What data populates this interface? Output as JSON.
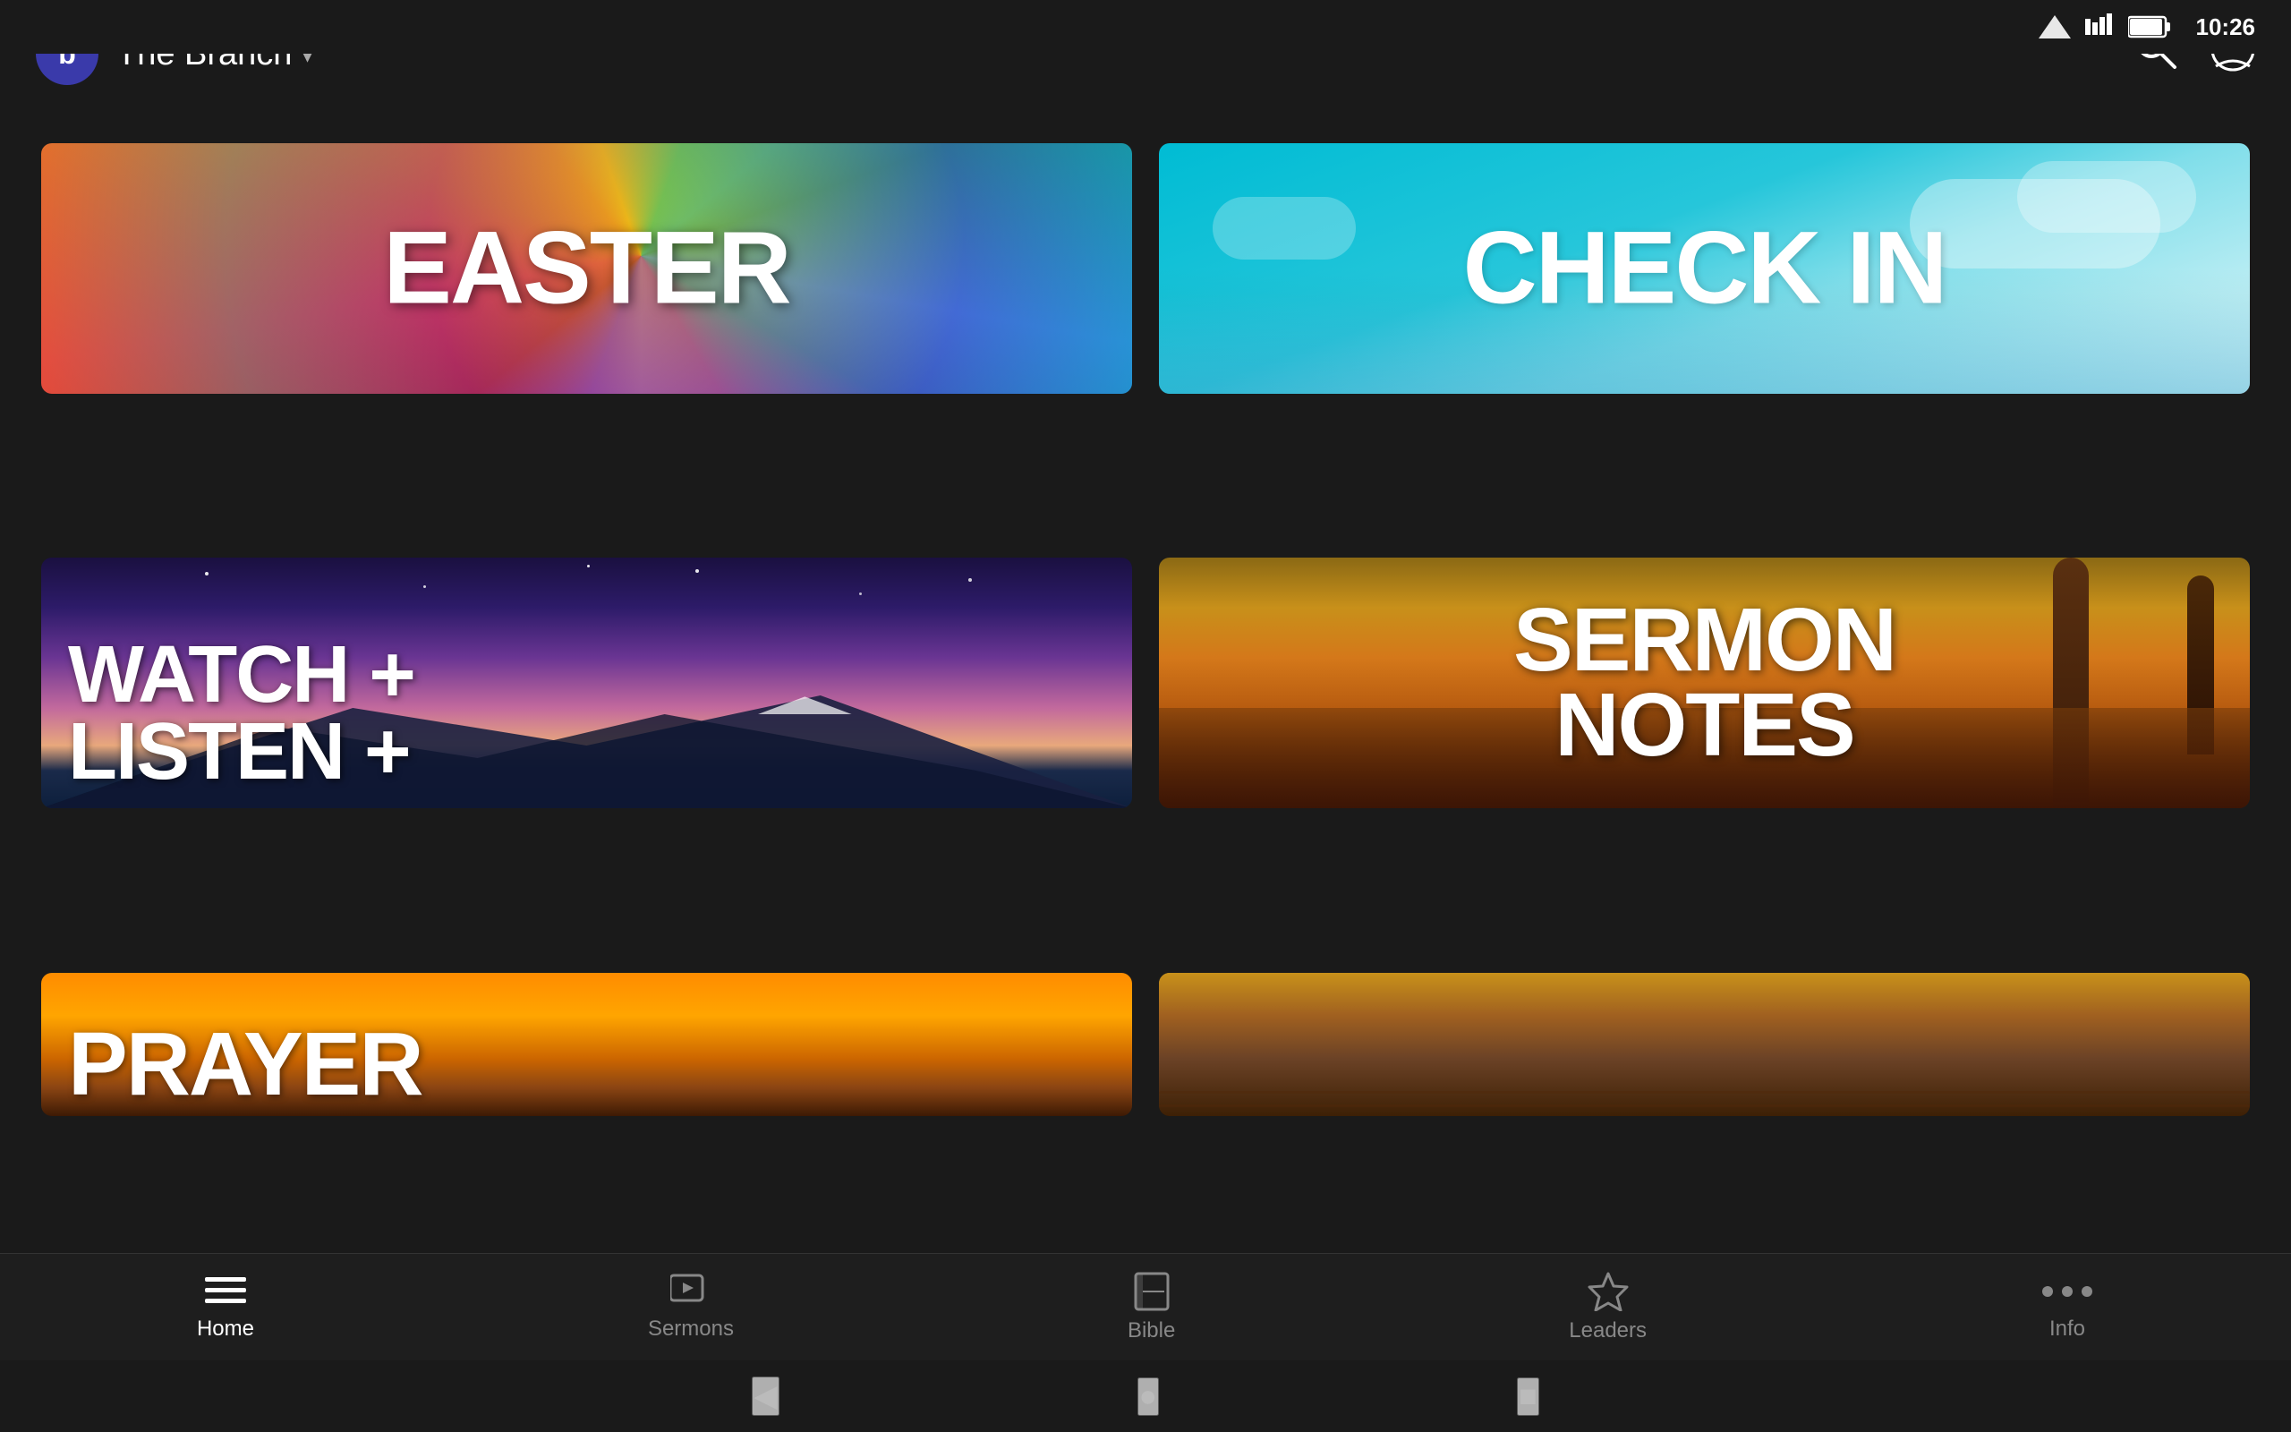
{
  "statusBar": {
    "time": "10:26",
    "icons": [
      "signal",
      "wifi",
      "battery"
    ]
  },
  "appBar": {
    "logoLetter": "b",
    "title": "The Branch",
    "chevron": "▾"
  },
  "cards": [
    {
      "id": "easter",
      "label": "EASTER",
      "type": "single-line"
    },
    {
      "id": "checkin",
      "label": "CHECK IN",
      "type": "single-line"
    },
    {
      "id": "watch-listen",
      "label": "WATCH +\nLISTEN +",
      "type": "multi-line"
    },
    {
      "id": "sermon-notes",
      "label": "SERMON\nNOTES",
      "type": "multi-line"
    },
    {
      "id": "prayer",
      "label": "PRAYER",
      "type": "partial"
    },
    {
      "id": "vineyard",
      "label": "",
      "type": "partial"
    }
  ],
  "bottomNav": {
    "items": [
      {
        "id": "home",
        "label": "Home",
        "icon": "list",
        "active": true
      },
      {
        "id": "sermons",
        "label": "Sermons",
        "icon": "play",
        "active": false
      },
      {
        "id": "bible",
        "label": "Bible",
        "icon": "book",
        "active": false
      },
      {
        "id": "leaders",
        "label": "Leaders",
        "icon": "star",
        "active": false
      },
      {
        "id": "info",
        "label": "Info",
        "icon": "dots",
        "active": false
      }
    ]
  },
  "systemNav": {
    "back": "◀",
    "home": "●",
    "recents": "■"
  }
}
